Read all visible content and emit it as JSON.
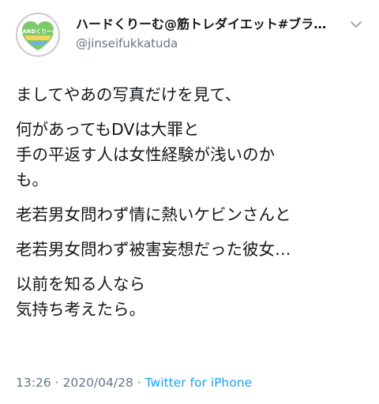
{
  "user": {
    "display_name": "ハードくりーむ@筋トレダイエット#ブラ…",
    "handle": "@jinseifukkatuda",
    "avatar_text": "HARDくりーむ",
    "avatar_subtext": "人生逆転せよ 筋トレ習慣"
  },
  "tweet": {
    "paragraphs": [
      [
        "ましてやあの写真だけを見て、"
      ],
      [
        "何があってもDVは大罪と",
        "手の平返す人は女性経験が浅いのか",
        "も。"
      ],
      [
        "老若男女問わず情に熱いケビンさんと"
      ],
      [
        "老若男女問わず被害妄想だった彼女…"
      ],
      [
        "以前を知る人なら",
        "気持ち考えたら。"
      ]
    ]
  },
  "meta": {
    "time": "13:26",
    "separator": "·",
    "date": "2020/04/28",
    "source": "Twitter for iPhone"
  },
  "colors": {
    "text": "#14171a",
    "secondary": "#657786",
    "link": "#1da1f2",
    "avatar_green": "#7ec96a",
    "avatar_yellow": "#f4d35e",
    "avatar_blue": "#6fb3d9"
  }
}
